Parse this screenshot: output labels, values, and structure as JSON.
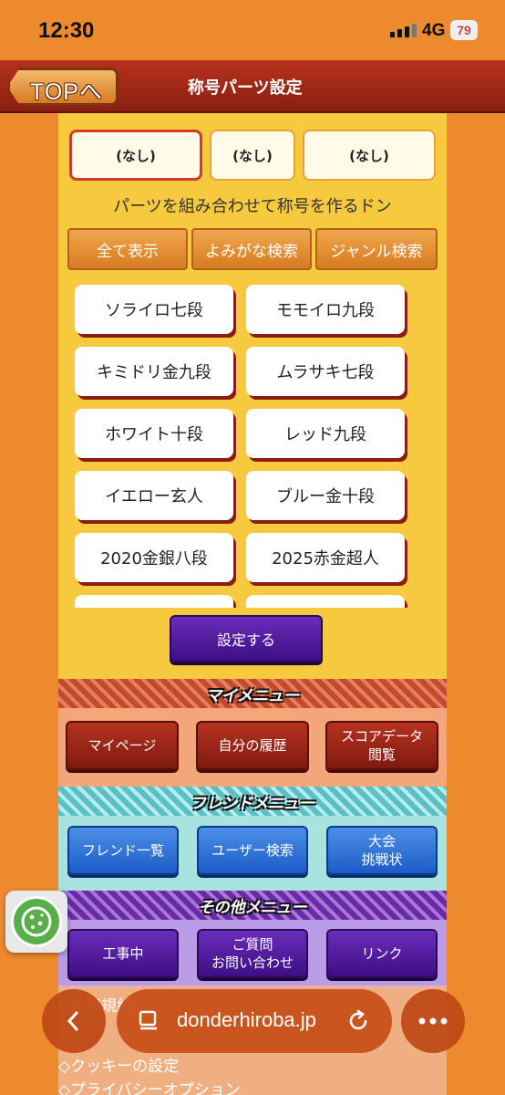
{
  "status": {
    "time": "12:30",
    "network": "4G",
    "battery": "79"
  },
  "header": {
    "top_button": "TOPへ",
    "title": "称号パーツ設定"
  },
  "slots": [
    "(なし)",
    "(なし)",
    "(なし)"
  ],
  "hint": "パーツを組み合わせて称号を作るドン",
  "filters": [
    "全て表示",
    "よみがな検索",
    "ジャンル検索"
  ],
  "parts": [
    "ソライロ七段",
    "モモイロ九段",
    "キミドリ金九段",
    "ムラサキ七段",
    "ホワイト十段",
    "レッド九段",
    "イエロー玄人",
    "ブルー金十段",
    "2020金銀八段",
    "2025赤金超人"
  ],
  "set_button": "設定する",
  "my_menu": {
    "title": "マイメニュー",
    "buttons": [
      "マイページ",
      "自分の履歴",
      "スコアデータ",
      "閲覧"
    ]
  },
  "friend_menu": {
    "title": "フレンドメニュー",
    "buttons": [
      "フレンド一覧",
      "ユーザー検索",
      "大会",
      "挑戦状"
    ]
  },
  "other_menu": {
    "title": "その他メニュー",
    "buttons": [
      "工事中",
      "ご質問",
      "お問い合わせ",
      "リンク"
    ]
  },
  "footer_links": [
    "◇利用規約",
    "◇クッキーの設定",
    "◇プライバシーオプション"
  ],
  "browser": {
    "url": "donderhiroba.jp"
  },
  "icons": {
    "back": "chevron-left-icon",
    "tabs": "tabs-icon",
    "reload": "reload-icon",
    "more": "more-icon",
    "cookie": "cookie-icon"
  }
}
